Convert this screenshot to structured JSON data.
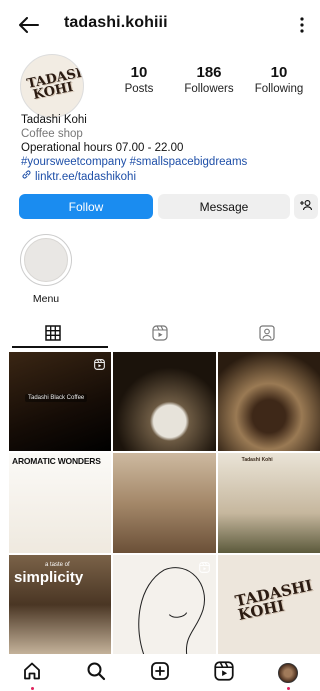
{
  "header": {
    "username": "tadashi.kohiii",
    "back_icon": "arrow-left-icon",
    "menu_icon": "more-vertical-icon"
  },
  "profile": {
    "avatar_text": "TADASHI KOHI",
    "stats": [
      {
        "value": "10",
        "label": "Posts"
      },
      {
        "value": "186",
        "label": "Followers"
      },
      {
        "value": "10",
        "label": "Following"
      }
    ],
    "name": "Tadashi Kohi",
    "category": "Coffee shop",
    "hours": "Operational hours 07.00 - 22.00",
    "hashtags": "#yoursweetcompany #smallspacebigdreams",
    "link": "linktr.ee/tadashikohi"
  },
  "actions": {
    "follow_label": "Follow",
    "message_label": "Message",
    "follow_color": "#1a8cf0"
  },
  "highlights": [
    {
      "label": "Menu"
    }
  ],
  "tabs": [
    {
      "name": "grid-icon",
      "active": true
    },
    {
      "name": "reels-icon",
      "active": false
    },
    {
      "name": "tagged-icon",
      "active": false
    }
  ],
  "posts": [
    {
      "caption": "Tadashi Black Coffee",
      "reel": true
    },
    {
      "caption": "",
      "reel": false
    },
    {
      "caption": "",
      "reel": false
    },
    {
      "caption": "AROMATIC WONDERS",
      "reel": false
    },
    {
      "caption": "",
      "reel": false
    },
    {
      "caption": "Tadashi Kohi",
      "reel": false
    },
    {
      "caption_small": "a taste of",
      "caption": "simplicity",
      "reel": false
    },
    {
      "caption": "",
      "reel": true
    },
    {
      "caption": "TADASHI KOHI",
      "reel": false
    }
  ],
  "navbar": [
    {
      "name": "home-icon",
      "notify": true
    },
    {
      "name": "search-icon",
      "notify": false
    },
    {
      "name": "create-icon",
      "notify": false
    },
    {
      "name": "reels-icon",
      "notify": false
    },
    {
      "name": "profile-avatar",
      "notify": true
    }
  ]
}
